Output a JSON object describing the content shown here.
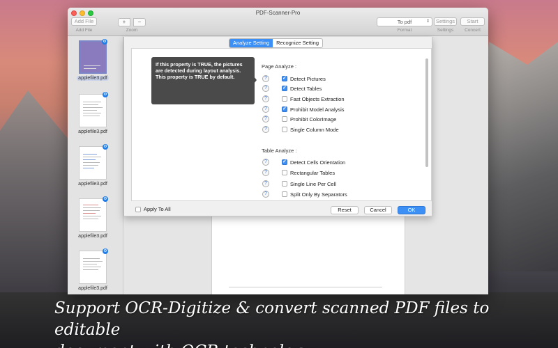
{
  "window": {
    "title": "PDF-Scanner-Pro"
  },
  "toolbar": {
    "add_file": "Add File",
    "add_file_caption": "Add File",
    "zoom_in": "+",
    "zoom_out": "−",
    "zoom_caption": "Zoom",
    "format_value": "To pdf",
    "format_caption": "Format",
    "settings": "Settings",
    "settings_caption": "Settings",
    "start": "Start",
    "start_caption": "Concert"
  },
  "sidebar": {
    "items": [
      {
        "label": "applefile3.pdf",
        "selected": true
      },
      {
        "label": "applefile3.pdf",
        "selected": false
      },
      {
        "label": "applefile3.pdf",
        "selected": false
      },
      {
        "label": "applefile3.pdf",
        "selected": false
      },
      {
        "label": "applefile3.pdf",
        "selected": false
      }
    ]
  },
  "dialog": {
    "tabs": [
      "Analyze Setting",
      "Recognize Setting"
    ],
    "active_tab": "Analyze Setting",
    "tooltip": "If this property is TRUE, the pictures are detected during layout analysis. This property is TRUE by default.",
    "page_analyze": {
      "title": "Page Analyze :",
      "options": [
        {
          "label": "Detect Pictures",
          "checked": true
        },
        {
          "label": "Detect Tables",
          "checked": true
        },
        {
          "label": "Fast Objects Extraction",
          "checked": false
        },
        {
          "label": "Prohibit Model Analysis",
          "checked": true
        },
        {
          "label": "Prohibit ColorImage",
          "checked": false
        },
        {
          "label": "Single Column Mode",
          "checked": false
        }
      ]
    },
    "table_analyze": {
      "title": "Table Analyze :",
      "options": [
        {
          "label": "Detect Cells Orientation",
          "checked": true
        },
        {
          "label": "Rectangular Tables",
          "checked": false
        },
        {
          "label": "Single Line Per Cell",
          "checked": false
        },
        {
          "label": "Split Only By Separators",
          "checked": false
        }
      ]
    },
    "help_glyph": "?",
    "apply_to_all": "Apply To All",
    "reset": "Reset",
    "cancel": "Cancel",
    "ok": "OK"
  },
  "caption": {
    "line1": "Support OCR-Digitize & convert scanned PDF files to editable",
    "line2": "document with OCR technology."
  },
  "colors": {
    "accent": "#3b8ff5",
    "tooltip_bg": "#4a4a4a"
  }
}
